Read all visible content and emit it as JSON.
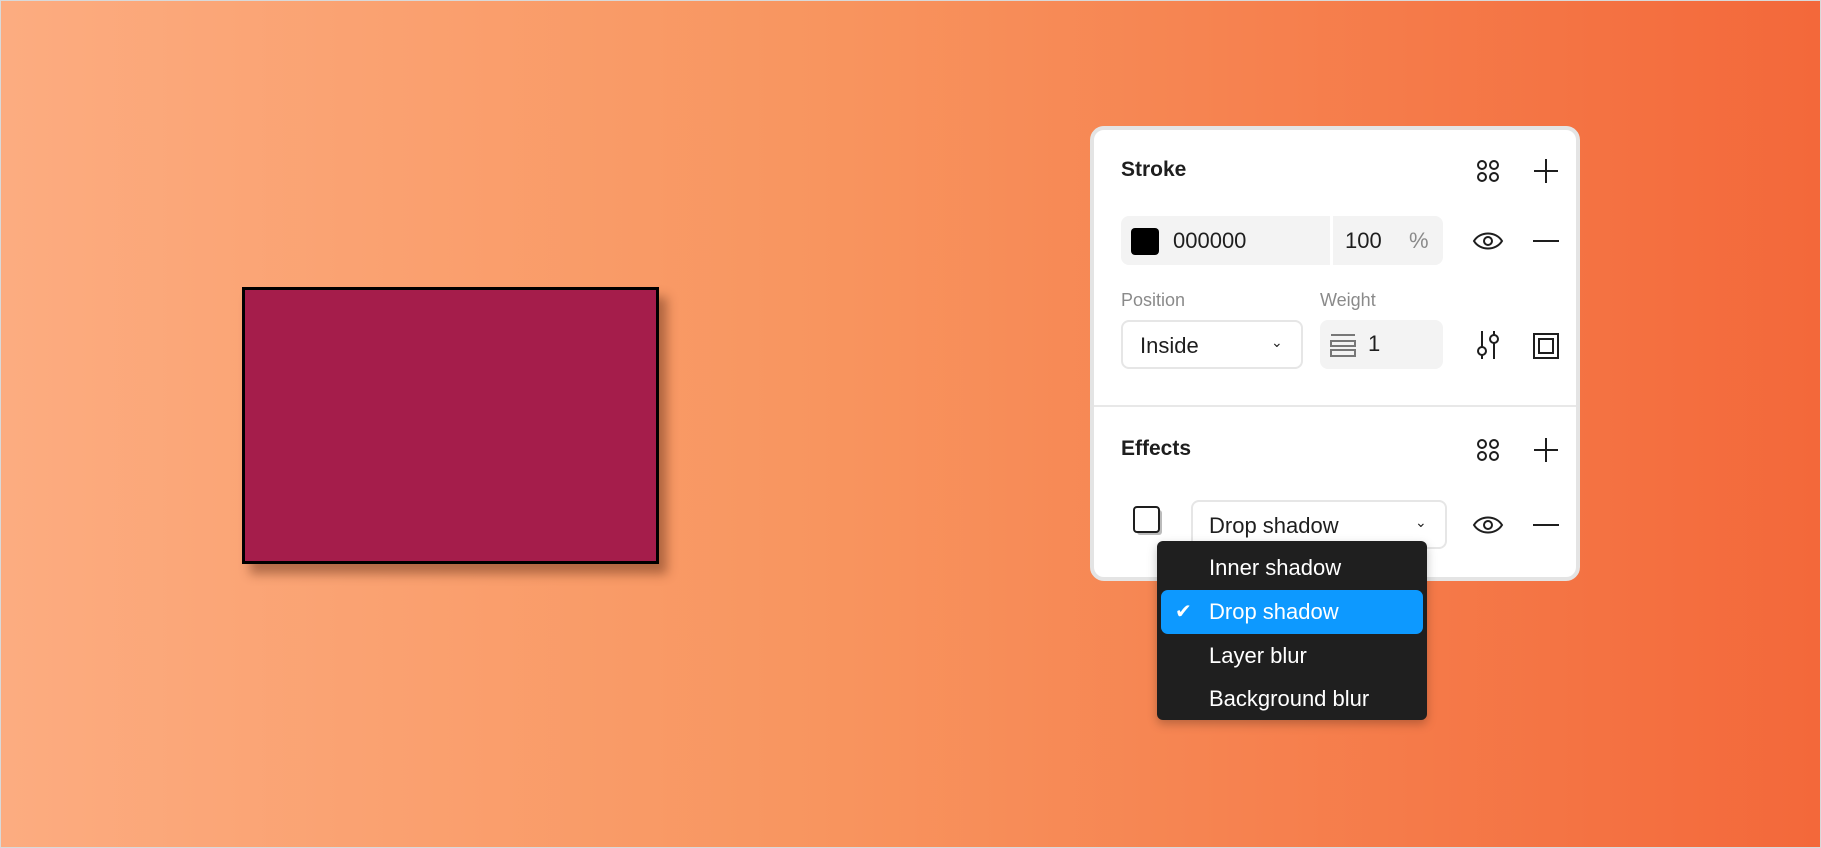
{
  "canvas": {
    "background_colors": [
      "#fcac80",
      "#f3683a"
    ],
    "shape_fill": "#a51d4b",
    "shape_stroke": "#000000"
  },
  "stroke": {
    "title": "Stroke",
    "color_hex": "000000",
    "color_swatch": "#000000",
    "opacity": "100",
    "opacity_unit": "%",
    "position_label": "Position",
    "position_value": "Inside",
    "weight_label": "Weight",
    "weight_value": "1"
  },
  "effects": {
    "title": "Effects",
    "type_value": "Drop shadow",
    "menu": {
      "items": [
        {
          "label": "Inner shadow",
          "selected": false
        },
        {
          "label": "Drop shadow",
          "selected": true
        },
        {
          "label": "Layer blur",
          "selected": false
        },
        {
          "label": "Background blur",
          "selected": false
        }
      ],
      "check": "✔",
      "accent": "#0d99ff"
    }
  }
}
